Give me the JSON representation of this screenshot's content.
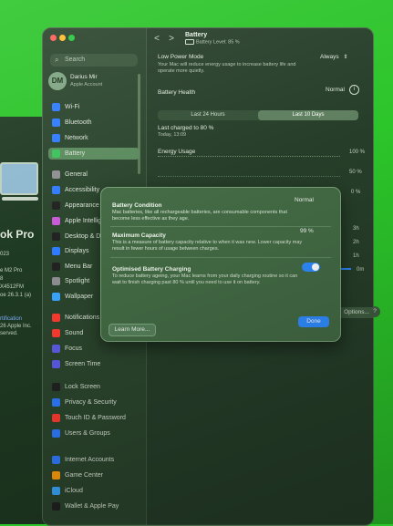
{
  "about": {
    "model": "ok Pro",
    "specs": [
      "023",
      "e M2 Pro",
      "8",
      "X4512FM",
      "oe 26.3.1 (a)"
    ],
    "link": "rtification",
    "copyright": [
      "26 Apple Inc.",
      "served."
    ]
  },
  "window": {
    "title": "Battery",
    "subtitle": "Battery Level: 85 %",
    "nav_back": "<",
    "nav_forward": ">"
  },
  "sidebar": {
    "search_placeholder": "Search",
    "account": {
      "initials": "DM",
      "name": "Darius Mir",
      "sub": "Apple Account"
    },
    "items": [
      {
        "label": "Wi-Fi",
        "icon": "wifi-icon",
        "color": "#2f7bff"
      },
      {
        "label": "Bluetooth",
        "icon": "bluetooth-icon",
        "color": "#2f7bff"
      },
      {
        "label": "Network",
        "icon": "network-icon",
        "color": "#2f7bff"
      },
      {
        "label": "Battery",
        "icon": "battery-icon",
        "color": "#3ac35a"
      },
      {
        "label": "General",
        "icon": "gear-icon",
        "color": "#8e8e93"
      },
      {
        "label": "Accessibility",
        "icon": "accessibility-icon",
        "color": "#2f7bff"
      },
      {
        "label": "Appearance",
        "icon": "appearance-icon",
        "color": "#222"
      },
      {
        "label": "Apple Intelligence",
        "icon": "intelligence-icon",
        "color": "#c85ad6"
      },
      {
        "label": "Desktop & Dock",
        "icon": "dock-icon",
        "color": "#222"
      },
      {
        "label": "Displays",
        "icon": "display-icon",
        "color": "#2f7bff"
      },
      {
        "label": "Menu Bar",
        "icon": "menubar-icon",
        "color": "#222"
      },
      {
        "label": "Spotlight",
        "icon": "spotlight-icon",
        "color": "#8e8e93"
      },
      {
        "label": "Wallpaper",
        "icon": "wallpaper-icon",
        "color": "#3aa6ff"
      },
      {
        "label": "Notifications",
        "icon": "bell-icon",
        "color": "#ff3b30"
      },
      {
        "label": "Sound",
        "icon": "sound-icon",
        "color": "#ff3b30"
      },
      {
        "label": "Focus",
        "icon": "moon-icon",
        "color": "#5e5ce6"
      },
      {
        "label": "Screen Time",
        "icon": "hourglass-icon",
        "color": "#5e5ce6"
      },
      {
        "label": "Lock Screen",
        "icon": "lock-icon",
        "color": "#222"
      },
      {
        "label": "Privacy & Security",
        "icon": "hand-icon",
        "color": "#2f7bff"
      },
      {
        "label": "Touch ID & Password",
        "icon": "fingerprint-icon",
        "color": "#ff3b30"
      },
      {
        "label": "Users & Groups",
        "icon": "users-icon",
        "color": "#2f7bff"
      },
      {
        "label": "Internet Accounts",
        "icon": "at-icon",
        "color": "#2f7bff"
      },
      {
        "label": "Game Center",
        "icon": "gamecenter-icon",
        "color": "#ff9f0a"
      },
      {
        "label": "iCloud",
        "icon": "cloud-icon",
        "color": "#3aa6ff"
      },
      {
        "label": "Wallet & Apple Pay",
        "icon": "wallet-icon",
        "color": "#222"
      }
    ]
  },
  "content": {
    "low_power_label": "Low Power Mode",
    "low_power_value": "Always",
    "low_power_desc": "Your Mac will reduce energy usage to increase battery life and operate more quietly.",
    "health_label": "Battery Health",
    "health_value": "Normal",
    "info_glyph": "i",
    "tabs": [
      "Last 24 Hours",
      "Last 10 Days"
    ],
    "last_charged": "Last charged to 80 %",
    "last_charged_time": "Today, 13:09",
    "energy_label": "Energy Usage",
    "energy_ticks": [
      "100 %",
      "50 %",
      "0 %"
    ],
    "time_ticks": [
      "3h",
      "2h",
      "1h",
      "0m"
    ],
    "axis_f": "F",
    "options_button": "Options...",
    "help": "?"
  },
  "chart_data": {
    "type": "bar",
    "title": "Energy Usage",
    "ylabel": "",
    "ylim": [
      0,
      100
    ],
    "categories": [],
    "values": [
      8
    ]
  },
  "dialog": {
    "condition_title": "Battery Condition",
    "condition_value": "Normal",
    "condition_desc": "Mac batteries, like all rechargeable batteries, are consumable components that become less effective as they age.",
    "capacity_title": "Maximum Capacity",
    "capacity_value": "99 %",
    "capacity_desc": "This is a measure of battery capacity relative to when it was new. Lower capacity may result in fewer hours of usage between charges.",
    "optimised_title": "Optimised Battery Charging",
    "optimised_desc": "To reduce battery ageing, your Mac learns from your daily charging routine so it can wait to finish charging past 80 % until you need to use it on battery.",
    "optimised_enabled": true,
    "learn_more": "Learn More...",
    "done": "Done"
  }
}
